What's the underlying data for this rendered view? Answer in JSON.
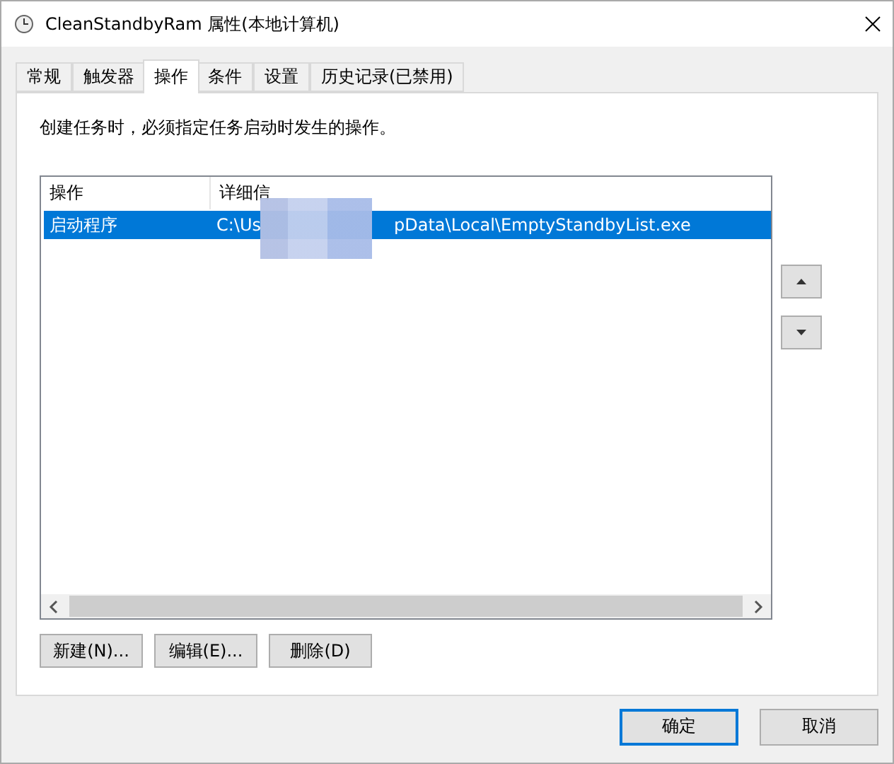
{
  "window": {
    "title": "CleanStandbyRam 属性(本地计算机)"
  },
  "tabs": [
    {
      "label": "常规",
      "selected": false
    },
    {
      "label": "触发器",
      "selected": false
    },
    {
      "label": "操作",
      "selected": true
    },
    {
      "label": "条件",
      "selected": false
    },
    {
      "label": "设置",
      "selected": false
    },
    {
      "label": "历史记录(已禁用)",
      "selected": false
    }
  ],
  "instruction": "创建任务时，必须指定任务启动时发生的操作。",
  "table": {
    "columns": [
      "操作",
      "详细信"
    ],
    "rows": [
      {
        "action": "启动程序",
        "details_start": "C:\\Us",
        "details_end": "pData\\Local\\EmptyStandbyList.exe",
        "selected": true
      }
    ]
  },
  "list_buttons": [
    "新建(N)...",
    "编辑(E)...",
    "删除(D)"
  ],
  "dialog_buttons": [
    {
      "label": "确定",
      "default": true
    },
    {
      "label": "取消",
      "default": false
    }
  ]
}
